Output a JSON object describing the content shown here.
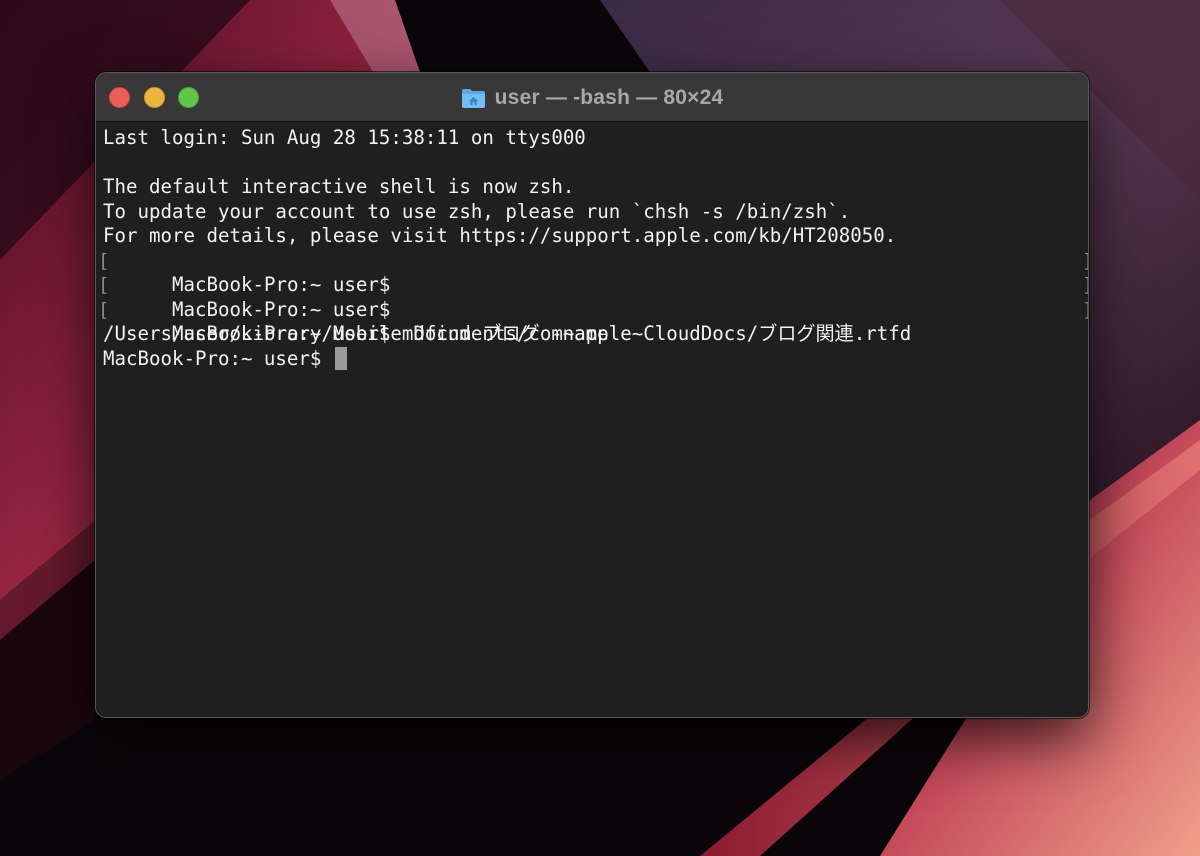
{
  "window": {
    "title": "user — -bash — 80×24"
  },
  "terminal": {
    "lines": [
      "Last login: Sun Aug 28 15:38:11 on ttys000",
      "",
      "The default interactive shell is now zsh.",
      "To update your account to use zsh, please run `chsh -s /bin/zsh`.",
      "For more details, please visit https://support.apple.com/kb/HT208050.",
      "MacBook-Pro:~ user$",
      "MacBook-Pro:~ user$",
      "MacBook-Pro:~ user$ mdfind ブログ -name",
      "/Users/user/Library/Mobile Documents/com~apple~CloudDocs/ブログ関連.rtfd",
      "MacBook-Pro:~ user$ "
    ],
    "bracket_left": "[",
    "bracket_right": "]"
  },
  "icons": {
    "title": "home-folder-icon",
    "traffic_lights": [
      "close-button",
      "minimize-button",
      "zoom-button"
    ]
  },
  "colors": {
    "close": "#ec5f57",
    "minimize": "#e9b53c",
    "zoom": "#5fc64a",
    "terminal_bg": "#1f1f1f",
    "titlebar_bg": "#383838",
    "text": "#f2f2f2"
  }
}
